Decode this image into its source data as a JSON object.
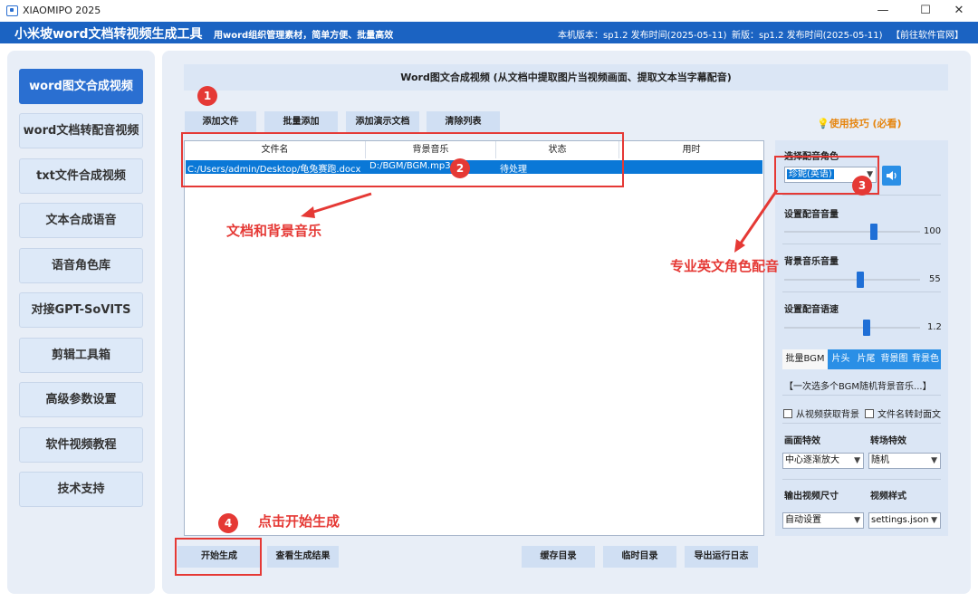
{
  "window": {
    "title": "XIAOMIPO 2025",
    "minimize": "—",
    "maximize": "☐",
    "close": "✕"
  },
  "header": {
    "app_name": "小米坡word文档转视频生成工具",
    "slogan": "用word组织管理素材，简单方便、批量高效",
    "local_version": "本机版本：sp1.2  发布时间(2025-05-11)",
    "new_version": "新版：sp1.2 发布时间(2025-05-11)",
    "website_link": "【前往软件官网】",
    "colors": {
      "brand": "#1b63c2",
      "accent": "#2a6fd1",
      "annotation": "#e53935"
    }
  },
  "sidebar": {
    "items": [
      {
        "label": "word图文合成视频",
        "active": true
      },
      {
        "label": "word文档转配音视频"
      },
      {
        "label": "txt文件合成视频"
      },
      {
        "label": "文本合成语音"
      },
      {
        "label": "语音角色库"
      },
      {
        "label": "对接GPT-SoVITS"
      },
      {
        "label": "剪辑工具箱"
      },
      {
        "label": "高级参数设置"
      },
      {
        "label": "软件视频教程"
      },
      {
        "label": "技术支持"
      }
    ]
  },
  "main": {
    "title": "Word图文合成视频 (从文档中提取图片当视频画面、提取文本当字幕配音)",
    "toolbar": {
      "add_file": "添加文件",
      "batch_add": "批量添加",
      "add_demo": "添加演示文档",
      "clear_list": "清除列表"
    },
    "tips": "💡使用技巧 (必看)",
    "table": {
      "columns": [
        "文件名",
        "背景音乐",
        "状态",
        "用时"
      ],
      "rows": [
        [
          "C:/Users/admin/Desktop/龟兔赛跑.docx",
          "D:/BGM/BGM.mp3",
          "待处理",
          ""
        ]
      ]
    },
    "bottom": {
      "start": "开始生成",
      "view_results": "查看生成结果",
      "cache_dir": "缓存目录",
      "temp_dir": "临时目录",
      "export_log": "导出运行日志"
    }
  },
  "right_panel": {
    "voice_label": "选择配音角色",
    "voice_value": "珍妮(英语)",
    "voice_volume_label": "设置配音音量",
    "voice_volume": "100",
    "bgm_volume_label": "背景音乐音量",
    "bgm_volume": "55",
    "speed_label": "设置配音语速",
    "speed": "1.2",
    "tabs": [
      "批量BGM",
      "片头",
      "片尾",
      "背景图",
      "背景色"
    ],
    "bgm_link": "【一次选多个BGM随机背景音乐...】",
    "chk_bg_from_video": "从视频获取背景",
    "chk_filename_cover": "文件名转封面文",
    "effect_label": "画面特效",
    "effect_value": "中心逐渐放大",
    "transition_label": "转场特效",
    "transition_value": "随机",
    "size_label": "输出视频尺寸",
    "size_value": "自动设置",
    "style_label": "视频样式",
    "style_value": "settings.json"
  },
  "annotations": {
    "n1": "1",
    "n2": "2",
    "n3": "3",
    "n4": "4",
    "doc_bgm": "文档和背景音乐",
    "english_voice": "专业英文角色配音",
    "click_start": "点击开始生成"
  }
}
